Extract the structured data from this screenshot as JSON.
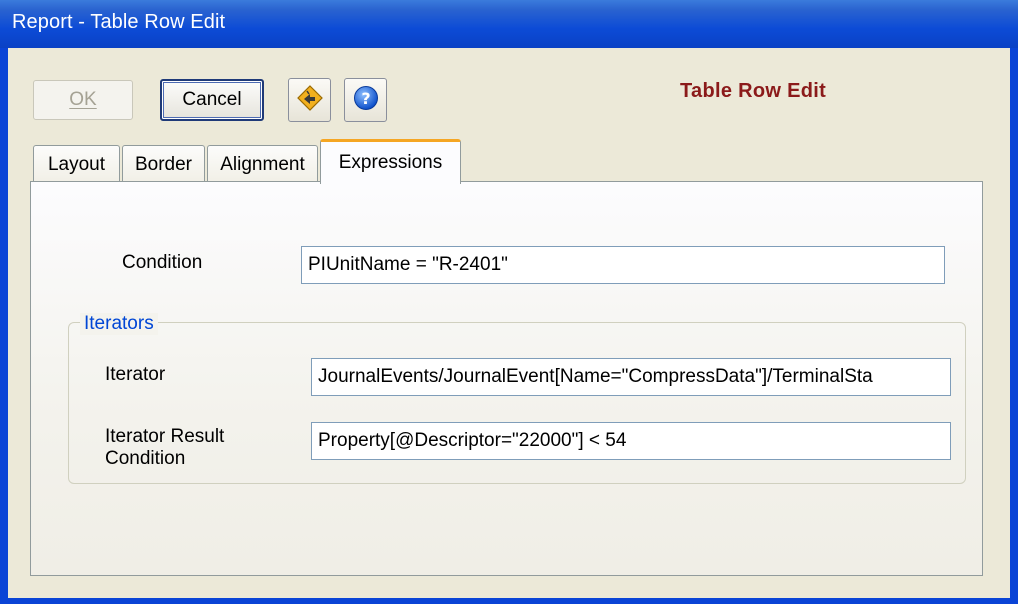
{
  "window": {
    "title": "Report - Table Row Edit"
  },
  "toolbar": {
    "ok_label": "OK",
    "cancel_label": "Cancel",
    "icons": [
      "tag-arrow-icon",
      "help-icon"
    ]
  },
  "heading": "Table Row Edit",
  "tabs": [
    {
      "label": "Layout"
    },
    {
      "label": "Border"
    },
    {
      "label": "Alignment"
    },
    {
      "label": "Expressions",
      "active": true
    }
  ],
  "form": {
    "condition_label": "Condition",
    "condition_value": "PIUnitName = \"R-2401\"",
    "iterators_group_label": "Iterators",
    "iterator_label": "Iterator",
    "iterator_value": "JournalEvents/JournalEvent[Name=\"CompressData\"]/TerminalSta",
    "result_label_line1": "Iterator Result",
    "result_label_line2": "Condition",
    "result_value": "Property[@Descriptor=\"22000\"] < 54"
  },
  "colors": {
    "titlebar": "#0a44d6",
    "heading": "#8b1a1a",
    "group_label": "#0046d5",
    "active_tab_accent": "#f5a623"
  }
}
